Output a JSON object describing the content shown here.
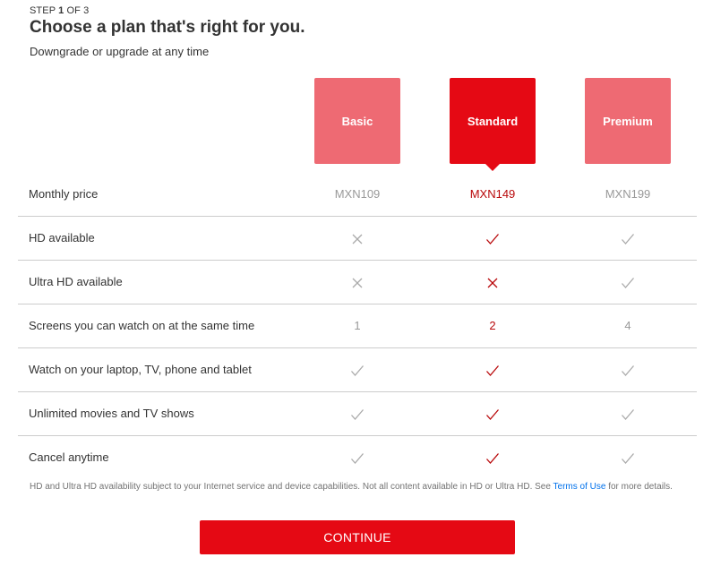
{
  "header": {
    "step_prefix": "STEP ",
    "step_current": "1",
    "step_suffix": " OF 3",
    "title": "Choose a plan that's right for you.",
    "subtitle": "Downgrade or upgrade at any time"
  },
  "plans": [
    {
      "name": "Basic",
      "selected": false
    },
    {
      "name": "Standard",
      "selected": true
    },
    {
      "name": "Premium",
      "selected": false
    }
  ],
  "features": [
    {
      "label": "Monthly price",
      "values": [
        "MXN109",
        "MXN149",
        "MXN199"
      ]
    },
    {
      "label": "HD available",
      "values": [
        "cross-icon",
        "check-icon",
        "check-icon"
      ]
    },
    {
      "label": "Ultra HD available",
      "values": [
        "cross-icon",
        "cross-icon",
        "check-icon"
      ]
    },
    {
      "label": "Screens you can watch on at the same time",
      "values": [
        "1",
        "2",
        "4"
      ]
    },
    {
      "label": "Watch on your laptop, TV, phone and tablet",
      "values": [
        "check-icon",
        "check-icon",
        "check-icon"
      ]
    },
    {
      "label": "Unlimited movies and TV shows",
      "values": [
        "check-icon",
        "check-icon",
        "check-icon"
      ]
    },
    {
      "label": "Cancel anytime",
      "values": [
        "check-icon",
        "check-icon",
        "check-icon"
      ]
    }
  ],
  "footnote": {
    "text_before": "HD and Ultra HD availability subject to your Internet service and device capabilities. Not all content available in HD or Ultra HD. See ",
    "link": "Terms of Use",
    "text_after": " for more details."
  },
  "continue_label": "CONTINUE",
  "colors": {
    "brand_red": "#e50914",
    "unselected_plan": "#ee6a73",
    "selected_text": "#b9090b",
    "muted_text": "#999999",
    "link": "#0071eb"
  }
}
